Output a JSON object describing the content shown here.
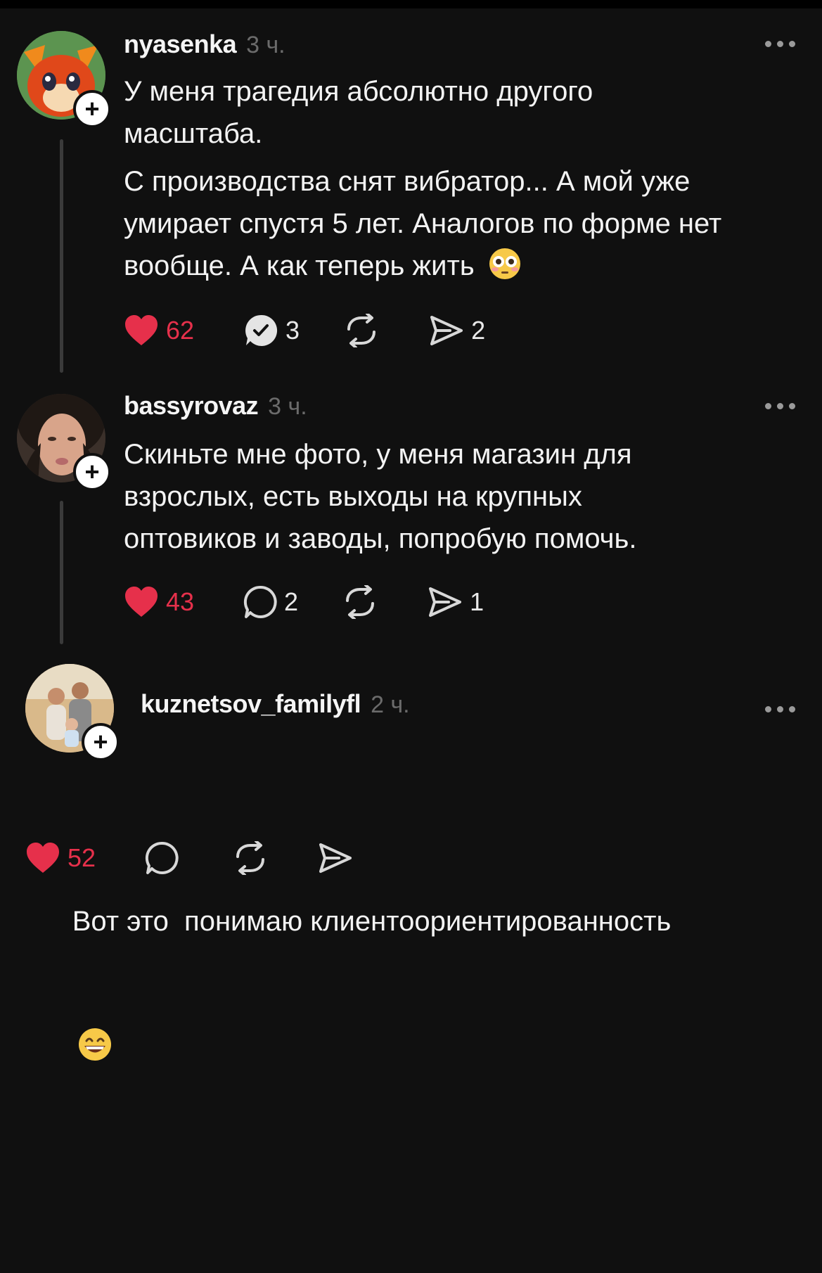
{
  "posts": [
    {
      "username": "nyasenka",
      "time": "3 ч.",
      "paragraphs": [
        "У меня трагедия абсолютно другого масштаба.",
        "С производства снят вибратор... А мой уже умирает спустя 5 лет. Аналогов по форме нет вообще. А как теперь жить"
      ],
      "emoji": "flushed-face",
      "likes": "62",
      "replies": "3",
      "shares": "2"
    },
    {
      "username": "bassyrovaz",
      "time": "3 ч.",
      "paragraphs": [
        "Скиньте мне фото, у меня магазин для взрослых, есть выходы на крупных оптовиков и заводы, попробую помочь."
      ],
      "likes": "43",
      "replies": "2",
      "shares": "1"
    },
    {
      "username": "kuznetsov_familyfl",
      "time": "2 ч.",
      "paragraphs": [
        "Вот это  понимаю клиентоориентированность"
      ],
      "emoji": "grinning-face",
      "likes": "52"
    }
  ],
  "colors": {
    "like": "#e6304b",
    "background": "#101010",
    "muted": "#6b6b6b"
  }
}
